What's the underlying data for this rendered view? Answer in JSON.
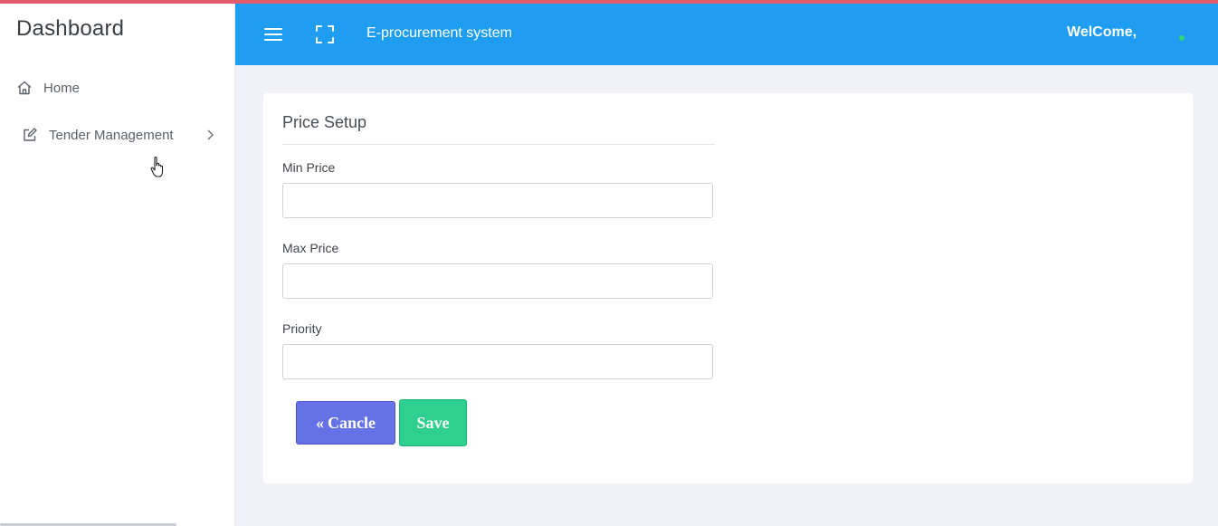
{
  "sidebar": {
    "brand": "Dashboard",
    "items": [
      {
        "label": "Home",
        "icon": "home-icon"
      },
      {
        "label": "Tender Management",
        "icon": "edit-icon",
        "has_submenu": true
      }
    ]
  },
  "topbar": {
    "title": "E-procurement system",
    "welcome": "WelCome,",
    "icons": [
      "menu-icon",
      "fullscreen-icon"
    ],
    "status_color": "#2fd67a"
  },
  "form": {
    "title": "Price Setup",
    "fields": [
      {
        "label": "Min Price",
        "value": ""
      },
      {
        "label": "Max Price",
        "value": ""
      },
      {
        "label": "Priority",
        "value": ""
      }
    ],
    "cancel_label": "Cancle",
    "save_label": "Save"
  },
  "colors": {
    "topbar": "#1f9ef1",
    "accent_stripe": "#e05c6a",
    "cancel_button": "#6572e6",
    "save_button": "#2fcf8f"
  }
}
